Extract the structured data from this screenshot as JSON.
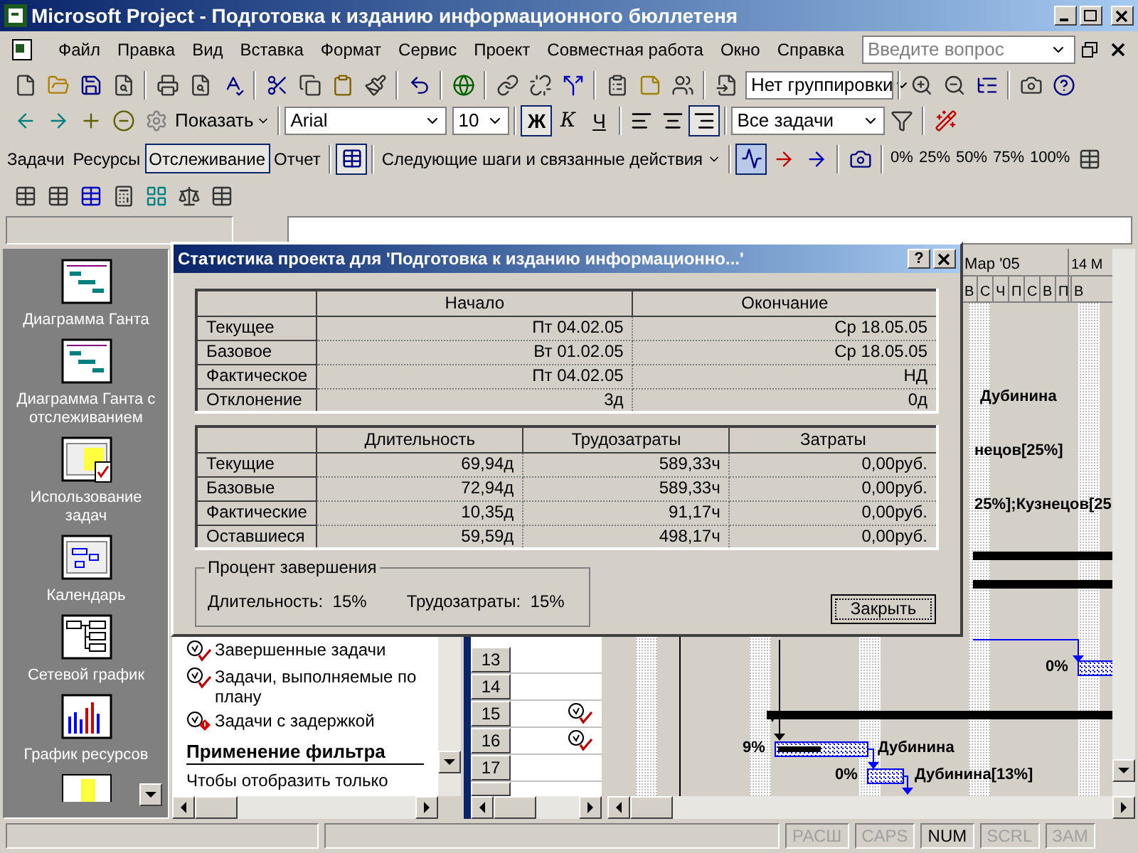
{
  "window": {
    "title": "Microsoft Project - Подготовка к изданию информационного бюллетеня"
  },
  "menu": [
    "Файл",
    "Правка",
    "Вид",
    "Вставка",
    "Формат",
    "Сервис",
    "Проект",
    "Совместная работа",
    "Окно",
    "Справка"
  ],
  "help_search": {
    "placeholder": "Введите вопрос"
  },
  "toolbar_standard": {
    "grouping": "Нет группировки"
  },
  "toolbar_formatting": {
    "show_button": "Показать",
    "font": "Arial",
    "size": "10",
    "styles": [
      {
        "label": "Ж",
        "kind": "bold",
        "on": true
      },
      {
        "label": "К",
        "kind": "italic",
        "on": false
      },
      {
        "label": "Ч",
        "kind": "underline",
        "on": false
      }
    ],
    "align": [
      {
        "kind": "left",
        "selected": false
      },
      {
        "kind": "center",
        "selected": false
      },
      {
        "kind": "right",
        "selected": true
      }
    ],
    "filter": "Все задачи"
  },
  "toolbar_guide": {
    "tabs": [
      {
        "label": "Задачи",
        "selected": false
      },
      {
        "label": "Ресурсы",
        "selected": false
      },
      {
        "label": "Отслеживание",
        "selected": true
      },
      {
        "label": "Отчет",
        "selected": false
      }
    ],
    "next_steps": "Следующие шаги и связанные действия",
    "percent_buttons": [
      "0%",
      "25%",
      "50%",
      "75%",
      "100%"
    ]
  },
  "views": [
    {
      "label": "Диаграмма Ганта"
    },
    {
      "label": "Диаграмма Ганта с отслеживанием"
    },
    {
      "label": "Использование задач"
    },
    {
      "label": "Календарь"
    },
    {
      "label": "Сетевой график"
    },
    {
      "label": "График ресурсов"
    }
  ],
  "task_pane": {
    "items": [
      {
        "kind": "check",
        "text": "Завершенные задачи"
      },
      {
        "kind": "check",
        "text": "Задачи, выполняемые по плану"
      },
      {
        "kind": "late",
        "text": "Задачи с задержкой"
      },
      {
        "kind": "heading",
        "text": "Применение фильтра"
      },
      {
        "kind": "para",
        "text": "Чтобы отобразить только"
      }
    ]
  },
  "task_table": {
    "rows": [
      {
        "id": "13",
        "indicator": false
      },
      {
        "id": "14",
        "indicator": false
      },
      {
        "id": "15",
        "indicator": true
      },
      {
        "id": "16",
        "indicator": true
      },
      {
        "id": "17",
        "indicator": false
      }
    ]
  },
  "gantt": {
    "month": "Мар '05",
    "month_next": "14 М",
    "days": [
      "В",
      "С",
      "Ч",
      "П",
      "С",
      "В",
      "П",
      "В"
    ],
    "labels": [
      "Дубинина",
      "нецов[25%]",
      "25%];Кузнецов[25",
      "0%",
      "9%",
      "Дубинина",
      "0%",
      "Дубинина[13%]"
    ]
  },
  "dialog": {
    "title": "Статистика проекта для 'Подготовка к изданию информационно...'",
    "help_button": "?",
    "dates_table": {
      "columns": [
        "Начало",
        "Окончание"
      ],
      "rows": [
        {
          "label": "Текущее",
          "values": [
            "Пт 04.02.05",
            "Ср 18.05.05"
          ]
        },
        {
          "label": "Базовое",
          "values": [
            "Вт 01.02.05",
            "Ср 18.05.05"
          ]
        },
        {
          "label": "Фактическое",
          "values": [
            "Пт 04.02.05",
            "НД"
          ]
        },
        {
          "label": "Отклонение",
          "values": [
            "3д",
            "0д"
          ]
        }
      ]
    },
    "totals_table": {
      "columns": [
        "Длительность",
        "Трудозатраты",
        "Затраты"
      ],
      "rows": [
        {
          "label": "Текущие",
          "values": [
            "69,94д",
            "589,33ч",
            "0,00руб."
          ]
        },
        {
          "label": "Базовые",
          "values": [
            "72,94д",
            "589,33ч",
            "0,00руб."
          ]
        },
        {
          "label": "Фактические",
          "values": [
            "10,35д",
            "91,17ч",
            "0,00руб."
          ]
        },
        {
          "label": "Оставшиеся",
          "values": [
            "59,59д",
            "498,17ч",
            "0,00руб."
          ]
        }
      ]
    },
    "completion": {
      "title": "Процент завершения",
      "items": [
        {
          "label": "Длительность:",
          "value": "15%"
        },
        {
          "label": "Трудозатраты:",
          "value": "15%"
        }
      ]
    },
    "close_button": "Закрыть"
  },
  "status_bar": {
    "indicators": [
      {
        "label": "РАСШ",
        "on": false
      },
      {
        "label": "CAPS",
        "on": false
      },
      {
        "label": "NUM",
        "on": true
      },
      {
        "label": "SCRL",
        "on": false
      },
      {
        "label": "ЗАМ",
        "on": false
      }
    ]
  }
}
